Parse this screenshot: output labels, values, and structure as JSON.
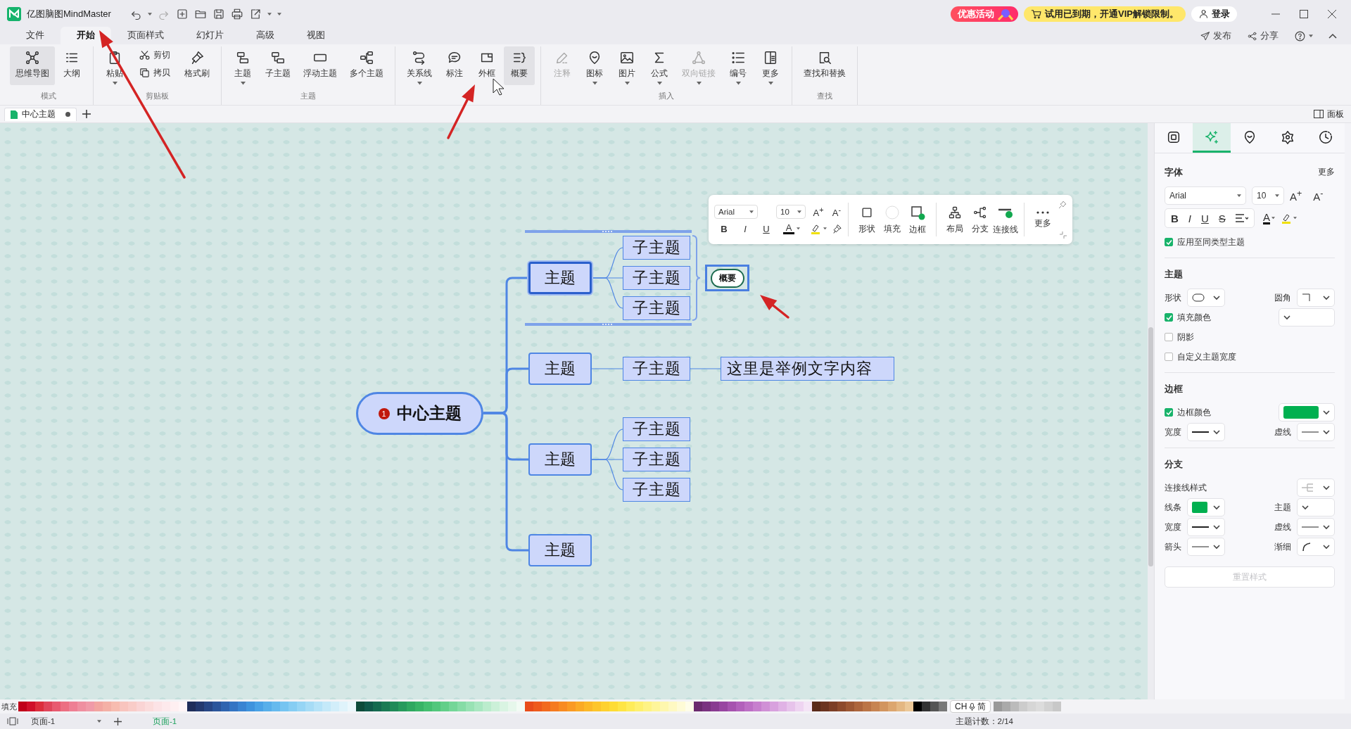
{
  "app": {
    "title": "亿图脑图MindMaster"
  },
  "promo": {
    "activity": "优惠活动",
    "trial": "试用已到期，开通VIP解锁限制。",
    "login": "登录"
  },
  "menu_tabs": [
    {
      "label": "文件",
      "selected": false
    },
    {
      "label": "开始",
      "selected": true
    },
    {
      "label": "页面样式",
      "selected": false
    },
    {
      "label": "幻灯片",
      "selected": false
    },
    {
      "label": "高级",
      "selected": false
    },
    {
      "label": "视图",
      "selected": false
    }
  ],
  "header_actions": [
    {
      "label": "发布"
    },
    {
      "label": "分享"
    }
  ],
  "ribbon_groups": [
    {
      "label": "模式",
      "items": [
        {
          "label": "思维导图",
          "kind": "large",
          "highlighted": true,
          "disabled": false,
          "dropdown": false
        },
        {
          "label": "大纲",
          "kind": "large",
          "highlighted": false,
          "disabled": false,
          "dropdown": false
        }
      ]
    },
    {
      "label": "剪贴板",
      "items": [
        {
          "label": "粘贴",
          "kind": "large",
          "highlighted": false,
          "disabled": false,
          "dropdown": true
        },
        {
          "label": "剪切",
          "kind": "small",
          "highlighted": false,
          "disabled": false,
          "dropdown": false
        },
        {
          "label": "拷贝",
          "kind": "small",
          "highlighted": false,
          "disabled": false,
          "dropdown": false
        },
        {
          "label": "格式刷",
          "kind": "large",
          "highlighted": false,
          "disabled": false,
          "dropdown": false
        }
      ]
    },
    {
      "label": "主题",
      "items": [
        {
          "label": "主题",
          "kind": "large",
          "highlighted": false,
          "disabled": false,
          "dropdown": true
        },
        {
          "label": "子主题",
          "kind": "large",
          "highlighted": false,
          "disabled": false,
          "dropdown": false
        },
        {
          "label": "浮动主题",
          "kind": "large",
          "highlighted": false,
          "disabled": false,
          "dropdown": false
        },
        {
          "label": "多个主题",
          "kind": "large",
          "highlighted": false,
          "disabled": false,
          "dropdown": false
        }
      ]
    },
    {
      "items": [
        {
          "label": "关系线",
          "kind": "large",
          "highlighted": false,
          "disabled": false,
          "dropdown": true
        },
        {
          "label": "标注",
          "kind": "large",
          "highlighted": false,
          "disabled": false,
          "dropdown": false
        },
        {
          "label": "外框",
          "kind": "large",
          "highlighted": false,
          "disabled": false,
          "dropdown": false
        },
        {
          "label": "概要",
          "kind": "large",
          "highlighted": true,
          "disabled": false,
          "dropdown": false
        }
      ]
    },
    {
      "label": "插入",
      "items": [
        {
          "label": "注释",
          "kind": "large",
          "highlighted": false,
          "disabled": true,
          "dropdown": false
        },
        {
          "label": "图标",
          "kind": "large",
          "highlighted": false,
          "disabled": false,
          "dropdown": true
        },
        {
          "label": "图片",
          "kind": "large",
          "highlighted": false,
          "disabled": false,
          "dropdown": true
        },
        {
          "label": "公式",
          "kind": "large",
          "highlighted": false,
          "disabled": false,
          "dropdown": true
        },
        {
          "label": "双向链接",
          "kind": "large",
          "highlighted": false,
          "disabled": true,
          "dropdown": true
        },
        {
          "label": "编号",
          "kind": "large",
          "highlighted": false,
          "disabled": false,
          "dropdown": true
        },
        {
          "label": "更多",
          "kind": "large",
          "highlighted": false,
          "disabled": false,
          "dropdown": true
        }
      ]
    },
    {
      "label": "查找",
      "items": [
        {
          "label": "查找和替换",
          "kind": "large",
          "highlighted": false,
          "disabled": false,
          "dropdown": false
        }
      ]
    }
  ],
  "doc_tabs": [
    {
      "label": "中心主题",
      "selected": true,
      "unsaved": true
    }
  ],
  "panel_toggle": "面板",
  "mind_map": {
    "central": {
      "text": "中心主题",
      "marker": "1"
    },
    "topics": [
      {
        "text": "主题",
        "selected": true,
        "summary": {
          "text": "概要",
          "selected": true
        },
        "children": [
          {
            "text": "子主题"
          },
          {
            "text": "子主题"
          },
          {
            "text": "子主题"
          }
        ]
      },
      {
        "text": "主题",
        "selected": false,
        "children": [
          {
            "text": "子主题",
            "children": [
              {
                "text": "这里是举例文字内容"
              }
            ]
          }
        ]
      },
      {
        "text": "主题",
        "selected": false,
        "children": [
          {
            "text": "子主题"
          },
          {
            "text": "子主题"
          },
          {
            "text": "子主题"
          }
        ]
      },
      {
        "text": "主题",
        "selected": false
      }
    ]
  },
  "floating_toolbar": {
    "font": "Arial",
    "size": "10",
    "grow": "A$^{+}$",
    "shrink": "A$^{-}$",
    "styles": [
      "B",
      "I",
      "U"
    ],
    "font_color": "A",
    "tools": [
      {
        "label": "形状"
      },
      {
        "label": "填充"
      },
      {
        "label": "边框"
      },
      {
        "label": "布局"
      },
      {
        "label": "分支"
      },
      {
        "label": "连接线"
      },
      {
        "label": "更多"
      }
    ]
  },
  "side_panel": {
    "tabs": [
      {
        "selected": false
      },
      {
        "selected": true
      },
      {
        "selected": false
      },
      {
        "selected": false
      },
      {
        "selected": false
      }
    ],
    "font": {
      "title": "字体",
      "more": "更多",
      "family": "Arial",
      "size": "10",
      "grow": "A$^{+}$",
      "shrink": "A$^{-}$",
      "styles": [
        "B",
        "I",
        "U",
        "S"
      ],
      "font_color": "A",
      "apply_same": {
        "label": "应用至同类型主题",
        "checked": true
      }
    },
    "topic": {
      "title": "主题",
      "shape_label": "形状",
      "corner_label": "圆角",
      "fill": {
        "label": "填充颜色",
        "checked": true
      },
      "shadow": {
        "label": "阴影",
        "checked": false
      },
      "custom_width": {
        "label": "自定义主题宽度",
        "checked": false
      }
    },
    "border": {
      "title": "边框",
      "color": {
        "label": "边框颜色",
        "checked": true,
        "color": "#00b050"
      },
      "width_label": "宽度",
      "dash_label": "虚线"
    },
    "branch": {
      "title": "分支",
      "style_label": "连接线样式",
      "line_label": "线条",
      "line_swatch": {
        "color": "#00b050"
      },
      "topic_label": "主题",
      "width_label": "宽度",
      "dash_label": "虚线",
      "arrow_label": "箭头",
      "taper_label": "渐细"
    },
    "reset": {
      "label": "重置样式",
      "disabled": true
    }
  },
  "palette": {
    "label": "填充",
    "swatches": [
      {
        "color": "#c0001a"
      },
      {
        "color": "#d0102a"
      },
      {
        "color": "#dc2d3c"
      },
      {
        "color": "#e0455a"
      },
      {
        "color": "#e85a70"
      },
      {
        "color": "#ec6f82"
      },
      {
        "color": "#ee7f94"
      },
      {
        "color": "#ef8fa0"
      },
      {
        "color": "#f09aa8"
      },
      {
        "color": "#f2a5a0"
      },
      {
        "color": "#f4b0a6"
      },
      {
        "color": "#f7bcb0"
      },
      {
        "color": "#f8c4be"
      },
      {
        "color": "#f9ccc8"
      },
      {
        "color": "#fad4d4"
      },
      {
        "color": "#fbdcdc"
      },
      {
        "color": "#fce3e6"
      },
      {
        "color": "#fde9ec"
      },
      {
        "color": "#feeff1"
      },
      {
        "color": "#fff5f7"
      },
      {
        "color": "#1f2d5a"
      },
      {
        "color": "#23386e"
      },
      {
        "color": "#274685"
      },
      {
        "color": "#2b559b"
      },
      {
        "color": "#2f64b0"
      },
      {
        "color": "#3474c3"
      },
      {
        "color": "#3a84d2"
      },
      {
        "color": "#3f93dd"
      },
      {
        "color": "#4aa2e6"
      },
      {
        "color": "#58afea"
      },
      {
        "color": "#66baee"
      },
      {
        "color": "#76c4f1"
      },
      {
        "color": "#86cdf3"
      },
      {
        "color": "#96d5f5"
      },
      {
        "color": "#a6dcf6"
      },
      {
        "color": "#b5e3f8"
      },
      {
        "color": "#c4e9f9"
      },
      {
        "color": "#d2eefa"
      },
      {
        "color": "#dff3fb"
      },
      {
        "color": "#ebf7fc"
      },
      {
        "color": "#0d4b3a"
      },
      {
        "color": "#10594a"
      },
      {
        "color": "#146a50"
      },
      {
        "color": "#1a7a54"
      },
      {
        "color": "#208a58"
      },
      {
        "color": "#279a5c"
      },
      {
        "color": "#2fa860"
      },
      {
        "color": "#38b466"
      },
      {
        "color": "#44bf70"
      },
      {
        "color": "#52c77c"
      },
      {
        "color": "#62cf89"
      },
      {
        "color": "#74d698"
      },
      {
        "color": "#86dca6"
      },
      {
        "color": "#98e2b4"
      },
      {
        "color": "#a9e7c1"
      },
      {
        "color": "#bbeccd"
      },
      {
        "color": "#cbf0d8"
      },
      {
        "color": "#d9f4e2"
      },
      {
        "color": "#e6f7eb"
      },
      {
        "color": "#f2fbf4"
      },
      {
        "color": "#e84c1a"
      },
      {
        "color": "#ee5a1c"
      },
      {
        "color": "#f26a1e"
      },
      {
        "color": "#f57b20"
      },
      {
        "color": "#f88b22"
      },
      {
        "color": "#fa9a24"
      },
      {
        "color": "#fbaa26"
      },
      {
        "color": "#fcb828"
      },
      {
        "color": "#fdc52b"
      },
      {
        "color": "#fed12f"
      },
      {
        "color": "#fedc35"
      },
      {
        "color": "#fee545"
      },
      {
        "color": "#feec5a"
      },
      {
        "color": "#fef070"
      },
      {
        "color": "#fef385"
      },
      {
        "color": "#fef59a"
      },
      {
        "color": "#fef7ae"
      },
      {
        "color": "#fef9c2"
      },
      {
        "color": "#fefbd6"
      },
      {
        "color": "#fefde9"
      },
      {
        "color": "#6b2a6e"
      },
      {
        "color": "#7a3280"
      },
      {
        "color": "#893b91"
      },
      {
        "color": "#9845a1"
      },
      {
        "color": "#a652af"
      },
      {
        "color": "#b260bb"
      },
      {
        "color": "#bd6fc5"
      },
      {
        "color": "#c77fce"
      },
      {
        "color": "#d090d6"
      },
      {
        "color": "#d8a1de"
      },
      {
        "color": "#e0b2e5"
      },
      {
        "color": "#e7c3eb"
      },
      {
        "color": "#eed4f1"
      },
      {
        "color": "#f4e4f6"
      },
      {
        "color": "#5a2a1a"
      },
      {
        "color": "#6b3420"
      },
      {
        "color": "#7c3e26"
      },
      {
        "color": "#8d4a2c"
      },
      {
        "color": "#9d5733"
      },
      {
        "color": "#ad653c"
      },
      {
        "color": "#bb7446"
      },
      {
        "color": "#c78452"
      },
      {
        "color": "#d2955f"
      },
      {
        "color": "#dca66f"
      },
      {
        "color": "#e4b782"
      },
      {
        "color": "#ecc898"
      },
      {
        "color": "#000000"
      },
      {
        "color": "#333333"
      },
      {
        "color": "#555555"
      },
      {
        "color": "#777777"
      }
    ],
    "trailing_swatches": [
      {
        "color": "#999999"
      },
      {
        "color": "#aaaaaa"
      },
      {
        "color": "#bbbbbb"
      },
      {
        "color": "#cccccc"
      },
      {
        "color": "#d6d6d6"
      },
      {
        "color": "#dcdcdc"
      },
      {
        "color": "#d2d2d2"
      },
      {
        "color": "#c8c8c8"
      }
    ]
  },
  "ime_indicator": {
    "language": "CH",
    "mode": "简"
  },
  "status_bar": {
    "page_select": "页面-1",
    "page_tabs": [
      {
        "label": "页面-1",
        "selected": true
      }
    ],
    "topic_count": "主题计数：2/14"
  },
  "annotations": [
    {
      "kind": "arrow"
    },
    {
      "kind": "arrow"
    },
    {
      "kind": "arrow"
    }
  ]
}
